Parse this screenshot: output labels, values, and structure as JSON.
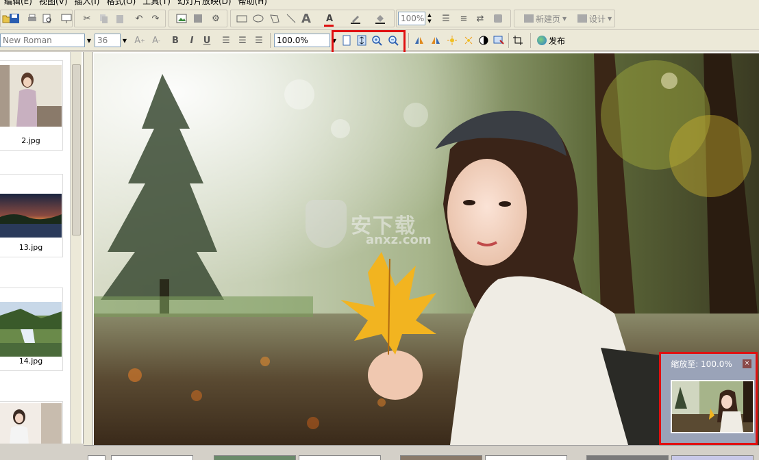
{
  "menu": [
    "编辑(E)",
    "视图(V)",
    "插入(I)",
    "格式(O)",
    "工具(T)",
    "幻灯片放映(D)",
    "帮助(H)"
  ],
  "toolbar1": {
    "zoom_value": "100%",
    "new_page_label": "新建页",
    "design_label": "设计"
  },
  "toolbar2": {
    "font_name": "New Roman",
    "font_size": "36",
    "bold": "B",
    "italic": "I",
    "underline": "U",
    "zoom_percent": "100.0%",
    "publish_label": "发布"
  },
  "thumbnails": [
    {
      "label": "2.jpg"
    },
    {
      "label": "13.jpg"
    },
    {
      "label": "14.jpg"
    },
    {
      "label": ""
    }
  ],
  "watermark": {
    "text": "安下载",
    "sub": "anxz.com"
  },
  "navigator": {
    "title": "缩放至: 100.0%",
    "close": "×"
  },
  "colors": {
    "highlight": "#e01010",
    "toolbar_bg": "#ece9d8"
  }
}
